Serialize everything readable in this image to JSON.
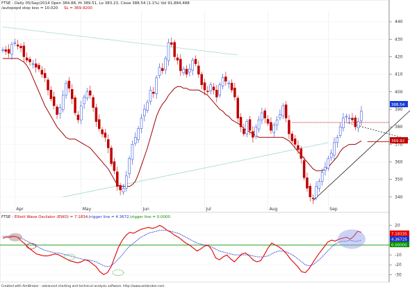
{
  "header": {
    "price_line": "FTSE - Daily 05/Sep/2014 Open 384.88, Hi 389.51, Lo 383.23, Close 388.54 (1.1%) Vol 91,884,488",
    "stop_line": "/autopopd stop loss = 10.020",
    "sl_text": "SL = 369.9200"
  },
  "ewo_header": {
    "title_prefix": "FTSE - ",
    "title_main": "Elliott Wave Oscilator (EWO) = 7.1834,",
    "trigger_label": "trigger line = 4.3672,",
    "zero_label": "trigger line = 0.0000"
  },
  "footer": "Created with AmiBroker - advanced charting and technical analysis software. http://www.amibroker.com",
  "price_badges": {
    "close": "388.54",
    "sl": "369.92"
  },
  "ewo_badges": {
    "ewo": "7.18335",
    "trigger": "4.36725",
    "zero": "0.00000"
  },
  "colors": {
    "up": "#1a3fd9",
    "down": "#c00000",
    "stop": "#a00000",
    "trigger": "#2233cc",
    "ewo": "#e00000",
    "zero": "#009000",
    "bg": "#ffffff"
  },
  "chart_data": [
    {
      "type": "candlestick",
      "title": "FTSE - Daily",
      "y_ticks": [
        "440",
        "430",
        "420",
        "410",
        "400",
        "390",
        "380",
        "370",
        "360",
        "350",
        "340"
      ],
      "x_ticks": [
        "Apr",
        "May",
        "Jun",
        "Jul",
        "Aug",
        "Sep"
      ],
      "ylim": [
        334,
        446
      ],
      "close": [
        424,
        423,
        422,
        427,
        428,
        426,
        425,
        420,
        418,
        417,
        416,
        414,
        413,
        410,
        408,
        401,
        396,
        392,
        387,
        391,
        398,
        405,
        402,
        396,
        388,
        384,
        392,
        397,
        400,
        398,
        391,
        383,
        379,
        376,
        374,
        368,
        359,
        355,
        346,
        344,
        345,
        352,
        362,
        370,
        374,
        379,
        385,
        390,
        394,
        401,
        399,
        408,
        414,
        412,
        419,
        428,
        427,
        420,
        418,
        412,
        413,
        410,
        413,
        418,
        416,
        410,
        404,
        401,
        400,
        404,
        401,
        397,
        404,
        408,
        406,
        405,
        401,
        397,
        385,
        380,
        376,
        383,
        378,
        374,
        380,
        384,
        388,
        385,
        382,
        378,
        381,
        384,
        387,
        392,
        385,
        376,
        372,
        370,
        367,
        362,
        351,
        345,
        340,
        339,
        346,
        349,
        354,
        357,
        362,
        365,
        371,
        374,
        380,
        385,
        386,
        385,
        384,
        380,
        383,
        389
      ],
      "open_offsets_desc": "bar bodies drawn from close series with small offsets",
      "stop_line": [
        419,
        419,
        419,
        419,
        419,
        419,
        418,
        417,
        415,
        412,
        408,
        404,
        400,
        396,
        392,
        389,
        386,
        383,
        380,
        378,
        376,
        374,
        373,
        373,
        373,
        372,
        371,
        370,
        369,
        368,
        366,
        364,
        362,
        360,
        358,
        356,
        353,
        350,
        347,
        346,
        346,
        346,
        346,
        347,
        349,
        353,
        358,
        363,
        368,
        374,
        380,
        386,
        390,
        393,
        395,
        398,
        400,
        402,
        403,
        403,
        402,
        402,
        401,
        401,
        401,
        401,
        400,
        399,
        398,
        396,
        394,
        392,
        390,
        389,
        387,
        386,
        384,
        383,
        382,
        381,
        379,
        378,
        377,
        376,
        375,
        374,
        374,
        374,
        374,
        374,
        374,
        374,
        374,
        374,
        373,
        372,
        370,
        368,
        366,
        364,
        362,
        360,
        358,
        356,
        355,
        355,
        355,
        356,
        357,
        359,
        361,
        363,
        366,
        368,
        369,
        370,
        370,
        370,
        371,
        372
      ],
      "trendlines": [
        {
          "from": [
            0,
            437
          ],
          "to": [
            78,
            421
          ],
          "color": "#8fd3cf"
        },
        {
          "from": [
            20,
            340
          ],
          "to": [
            108,
            371
          ],
          "color": "#8fd3cf"
        },
        {
          "from": [
            103,
            338
          ],
          "to": [
            145,
            405
          ],
          "color": "#000000"
        },
        {
          "from": [
            113,
            383
          ],
          "to": [
            145,
            368
          ],
          "color": "#000000",
          "dashed": true
        }
      ],
      "hlines": [
        {
          "y": 382.5,
          "from": 96,
          "to": 145,
          "color": "#c00000",
          "dashed": true
        },
        {
          "y": 371.5,
          "from": 121,
          "to": 145,
          "color": "#c00000"
        }
      ]
    },
    {
      "type": "line",
      "title": "Elliott Wave Oscilator (EWO)",
      "y_ticks": [
        "20",
        "10",
        "0",
        "-10",
        "-20",
        "-30"
      ],
      "ylim": [
        -34,
        24
      ],
      "series": [
        {
          "name": "Elliott Wave Oscilator (EWO)",
          "values": [
            7,
            8,
            8,
            9,
            8,
            4,
            1,
            -3,
            -6,
            -9,
            -10,
            -11,
            -11,
            -10,
            -9,
            -10,
            -12,
            -14,
            -16,
            -17,
            -18,
            -17,
            -15,
            -16,
            -19,
            -22,
            -27,
            -30,
            -28,
            -22,
            -12,
            -2,
            5,
            10,
            13,
            12,
            14,
            16,
            17,
            18,
            17,
            18,
            20,
            18,
            15,
            13,
            10,
            8,
            5,
            2,
            0,
            -3,
            -6,
            -4,
            -1,
            0,
            -5,
            -13,
            -15,
            -12,
            -10,
            -14,
            -17,
            -13,
            -9,
            -8,
            -11,
            -15,
            -17,
            -16,
            -10,
            -3,
            2,
            0,
            -2,
            -5,
            -9,
            -14,
            -18,
            -22,
            -27,
            -28,
            -24,
            -18,
            -12,
            -7,
            -2,
            3,
            5,
            4,
            6,
            7,
            8,
            6,
            9,
            14,
            13
          ]
        },
        {
          "name": "trigger line",
          "values": [
            9,
            9,
            9,
            9,
            8,
            7,
            5,
            3,
            1,
            -1,
            -3,
            -5,
            -6,
            -7,
            -8,
            -8,
            -9,
            -10,
            -11,
            -12,
            -13,
            -14,
            -15,
            -15,
            -16,
            -17,
            -19,
            -21,
            -22,
            -21,
            -18,
            -14,
            -10,
            -5,
            -1,
            2,
            5,
            8,
            10,
            12,
            13,
            14,
            15,
            15,
            15,
            14,
            13,
            12,
            10,
            8,
            6,
            4,
            2,
            1,
            0,
            -1,
            -2,
            -4,
            -6,
            -7,
            -8,
            -9,
            -10,
            -10,
            -10,
            -10,
            -10,
            -11,
            -12,
            -12,
            -12,
            -11,
            -9,
            -7,
            -6,
            -6,
            -7,
            -9,
            -11,
            -14,
            -17,
            -20,
            -21,
            -20,
            -17,
            -14,
            -10,
            -6,
            -2,
            1,
            3,
            4,
            4,
            5,
            4,
            4,
            5
          ]
        },
        {
          "name": "trigger line (zero)",
          "values": [
            0
          ]
        }
      ]
    }
  ]
}
